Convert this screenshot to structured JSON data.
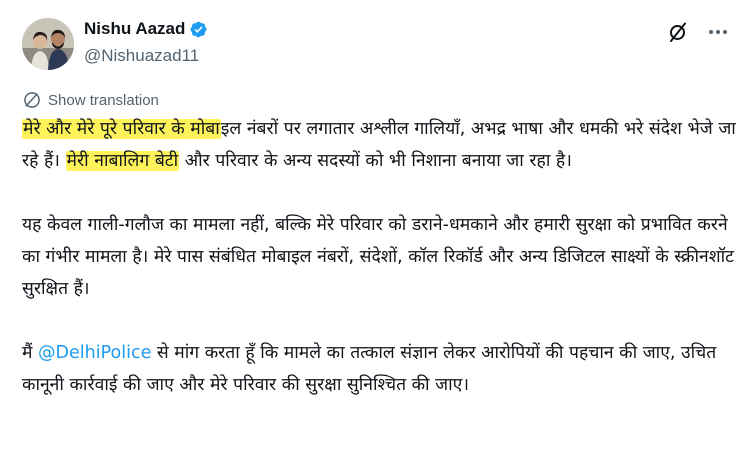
{
  "author": {
    "display_name": "Nishu Aazad",
    "handle": "@Nishuazad11",
    "verified": true
  },
  "actions": {
    "grok_icon": "grok-slash-icon",
    "more_icon": "more-horizontal-icon"
  },
  "translation": {
    "label": "Show translation"
  },
  "tweet": {
    "p1_hl1": "मेरे और मेरे पूरे परिवार के मोबा",
    "p1_t1": "इल नंबरों पर लगातार अश्लील गालियाँ, अभद्र भाषा और धमकी भरे संदेश भेजे जा रहे हैं। ",
    "p1_hl2": "मेरी नाबालिग बेटी",
    "p1_t2": " और परिवार के अन्य सदस्यों को भी निशाना बनाया जा रहा है।",
    "p2": "यह केवल गाली-गलौज का मामला नहीं, बल्कि मेरे परिवार को डराने-धमकाने और हमारी सुरक्षा को प्रभावित करने का गंभीर मामला है। मेरे पास संबंधित मोबाइल नंबरों, संदेशों, कॉल रिकॉर्ड और अन्य डिजिटल साक्ष्यों के स्क्रीनशॉट सुरक्षित हैं।",
    "p3_t1": "मैं ",
    "p3_mention": "@DelhiPolice",
    "p3_t2": " से मांग करता हूँ कि मामले का तत्काल संज्ञान लेकर आरोपियों की पहचान की जाए, उचित कानूनी कार्रवाई की जाए और मेरे परिवार की सुरक्षा सुनिश्चित की जाए।"
  },
  "colors": {
    "highlight": "#fff35a",
    "link": "#1d9bf0",
    "verified": "#1d9bf0",
    "secondary_text": "#536471"
  }
}
